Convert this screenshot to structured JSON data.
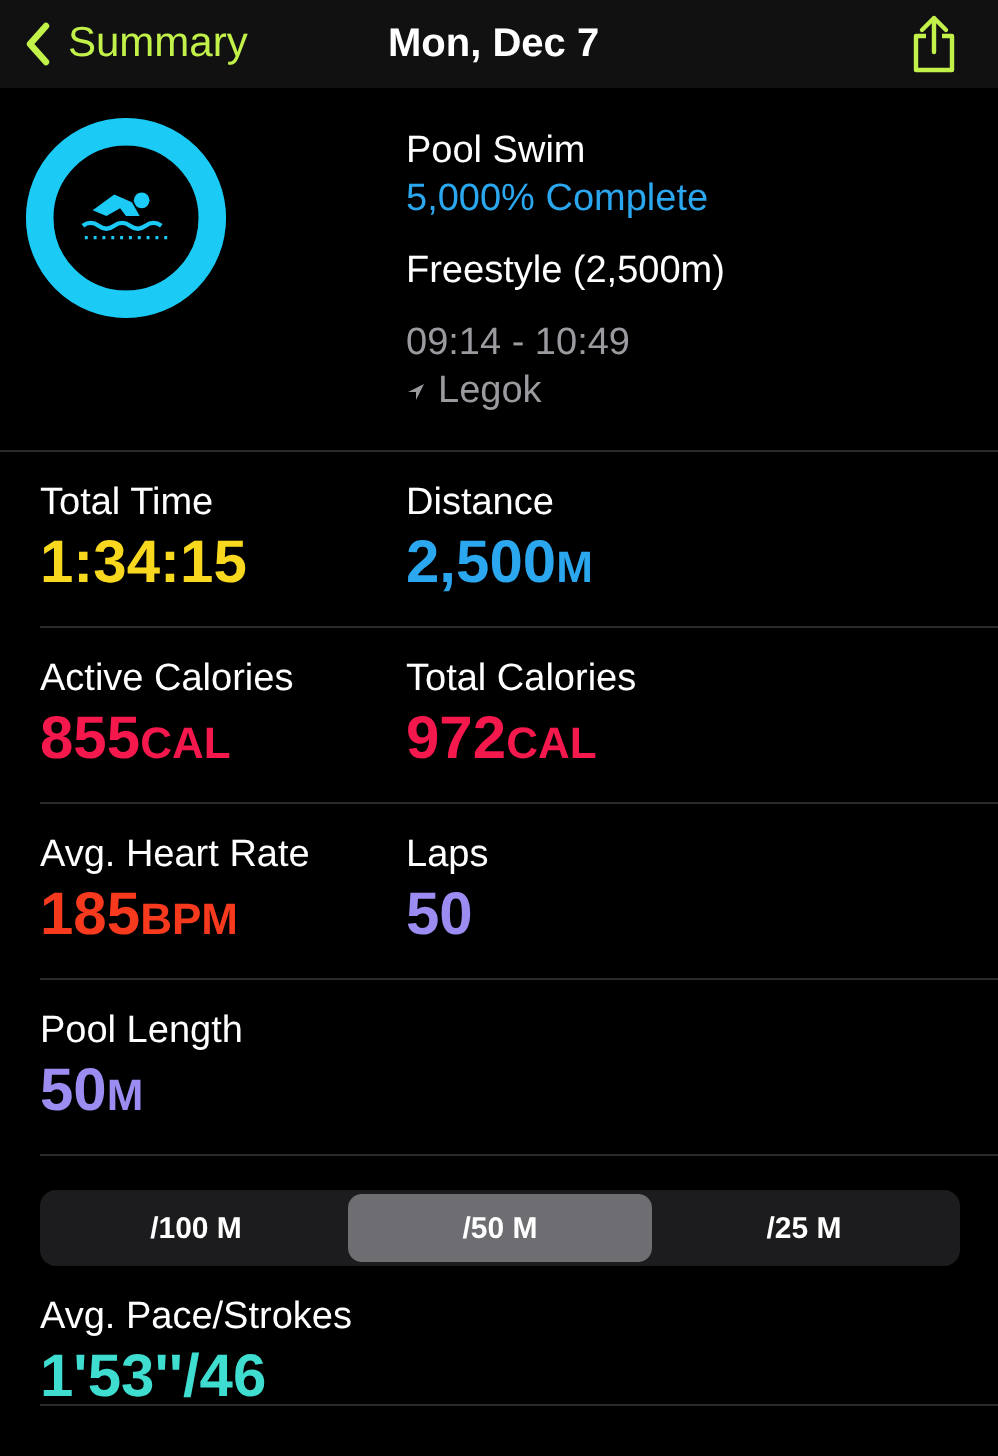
{
  "header": {
    "back": "Summary",
    "title": "Mon, Dec 7"
  },
  "workout": {
    "ring": {
      "level": 1
    },
    "name": "Pool Swim",
    "progress": "5,000% Complete",
    "stroke": "Freestyle (2,500m)",
    "time_range": "09:14 - 10:49",
    "location": "Legok"
  },
  "metric_rows": [
    [
      {
        "label": "Total Time",
        "value": "1:34:15",
        "color": "#f7d81e"
      },
      {
        "label": "Distance",
        "value": "2,500",
        "unit": "M",
        "color": "#2aa7ee"
      }
    ],
    [
      {
        "label": "Active Calories",
        "value": "855",
        "unit": "CAL",
        "color": "#f5184d"
      },
      {
        "label": "Total Calories",
        "value": "972",
        "unit": "CAL",
        "color": "#f5184d"
      }
    ],
    [
      {
        "label": "Avg. Heart Rate",
        "value": "185",
        "unit": "BPM",
        "color": "#f7391e"
      },
      {
        "label": "Laps",
        "value": "50",
        "color": "#9a8cf0"
      }
    ],
    [
      {
        "label": "Pool Length",
        "value": "50",
        "unit": "M",
        "color": "#9a8cf0"
      }
    ]
  ],
  "segments": [
    {
      "label": "/100 M",
      "selected": false
    },
    {
      "label": "/50 M",
      "selected": true
    },
    {
      "label": "/25 M",
      "selected": false
    }
  ],
  "pace": {
    "label": "Avg. Pace/Strokes",
    "value": "1'53''/46",
    "color": "#3fdcd0"
  }
}
